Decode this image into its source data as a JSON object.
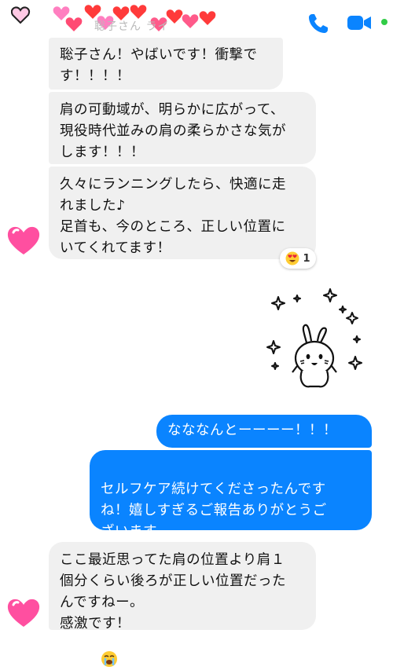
{
  "header": {
    "contact_name": "聡子さん ライ",
    "icons": {
      "call": "phone-icon",
      "video": "video-camera-icon",
      "status": "online-dot"
    },
    "colors": {
      "accent": "#0a84ff",
      "online": "#31cc46"
    }
  },
  "messages": [
    {
      "direction": "received",
      "text": "聡子さん！やばいです！衝撃で\nす！！！！"
    },
    {
      "direction": "received",
      "text": "肩の可動域が、明らかに広がって、\n現役時代並みの肩の柔らかさな気が\nします！！！"
    },
    {
      "direction": "received",
      "text": "久々にランニングしたら、快適に走\nれました♪\n足首も、今のところ、正しい位置に\nいてくれてます！"
    },
    {
      "direction": "sent",
      "text": "なななんとーーーー！！！"
    },
    {
      "direction": "sent",
      "text": "セルフケア続けてくださったんです\nね！嬉しすぎるご報告ありがとうご\nざいます"
    },
    {
      "direction": "received",
      "text": "ここ最近思ってた肩の位置より肩１\n個分くらい後ろが正しい位置だった\nんですねー。\n感激です！"
    }
  ],
  "reaction": {
    "emoji": "heart-eyes-emoji",
    "count": "1"
  },
  "sticker": {
    "name": "sparkle-rabbit-sticker"
  },
  "colors": {
    "sent_bubble": "#0a84ff",
    "received_bubble": "#f0f0f0",
    "heart": "#ff4fa0"
  }
}
